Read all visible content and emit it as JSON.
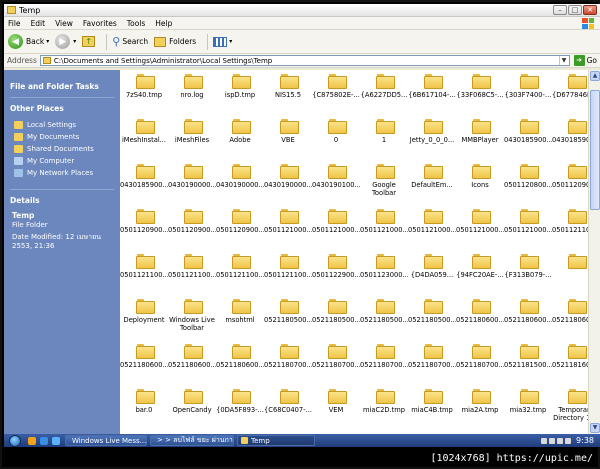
{
  "window": {
    "title": "Temp",
    "controls": {
      "minimize": "–",
      "maximize": "□",
      "close": "✕"
    }
  },
  "menu": [
    "File",
    "Edit",
    "View",
    "Favorites",
    "Tools",
    "Help"
  ],
  "toolbar": {
    "back": "Back",
    "search": "Search",
    "folders": "Folders"
  },
  "address": {
    "label": "Address",
    "value": "C:\\Documents and Settings\\Administrator\\Local Settings\\Temp",
    "go": "Go"
  },
  "sidebar": {
    "file_tasks_header": "File and Folder Tasks",
    "other_places_header": "Other Places",
    "other_places": [
      {
        "label": "Local Settings",
        "icon": "folder-icon",
        "color": "#f3cf5b"
      },
      {
        "label": "My Documents",
        "icon": "my-documents-icon",
        "color": "#f3cf5b"
      },
      {
        "label": "Shared Documents",
        "icon": "shared-documents-icon",
        "color": "#f3cf5b"
      },
      {
        "label": "My Computer",
        "icon": "my-computer-icon",
        "color": "#b8d0f0"
      },
      {
        "label": "My Network Places",
        "icon": "network-places-icon",
        "color": "#9fc3e8"
      }
    ],
    "details_header": "Details",
    "details": {
      "name": "Temp",
      "type": "File Folder",
      "modified_line1": "Date Modified: 12 เมษายน",
      "modified_line2": "2553, 21:36"
    }
  },
  "items": [
    "7zS40.tmp",
    "nro.log",
    "ispD.tmp",
    "NIS15.5",
    "{C875802E-...",
    "{A6227DD5...",
    "{6B617104-...",
    "{33F068C5-...",
    "{303F7400-...",
    "{D677846E-...",
    "iMeshInstal...",
    "iMeshFiles",
    "Adobe",
    "VBE",
    "0",
    "1",
    "Jetty_0_0_0...",
    "MMBPlayer",
    "0430185900...",
    "0430185900...",
    "0430185900...",
    "0430190000...",
    "0430190000...",
    "0430190000...",
    "0430190100...",
    "Google Toolbar",
    "DefaultEm...",
    "Icons",
    "0501120800...",
    "0501120900...",
    "0501120900...",
    "0501120900...",
    "0501120900...",
    "0501121000...",
    "0501121000...",
    "0501121000...",
    "0501121000...",
    "0501121000...",
    "0501121000...",
    "0501121100...",
    "0501121100...",
    "0501121100...",
    "0501121100...",
    "0501121100...",
    "0501122900...",
    "0501123000...",
    "{D4DA059...",
    "{94FC20AE-...",
    "{F313B079-...",
    "",
    "Deployment",
    "Windows Live Toolbar",
    "msohtml",
    "0521180500...",
    "0521180500...",
    "0521180500...",
    "0521180500...",
    "0521180600...",
    "0521180600...",
    "0521180600...",
    "0521180600...",
    "0521180600...",
    "0521180600...",
    "0521180700...",
    "0521180700...",
    "0521180700...",
    "0521180700...",
    "0521180700...",
    "0521181500...",
    "0521181600...",
    "bar.0",
    "OpenCandy",
    "{0DA5F893-...",
    "{C68C0407-...",
    "VEM",
    "miaC2D.tmp",
    "miaC4B.tmp",
    "mia2A.tmp",
    "mia32.tmp",
    "Temporary Directory 1 ..."
  ],
  "taskbar": {
    "tasks": [
      {
        "label": "Windows Live Mess...",
        "color": "#5aa0e6"
      },
      {
        "label": "> > ลบไฟล์ ขยะ ผ่านการ ... มี...",
        "color": "#e8761c"
      },
      {
        "label": "Temp",
        "color": "#f3cf5b"
      }
    ],
    "clock": "9:38"
  },
  "watermark": "[1024x768] https://upic.me/",
  "colors": {
    "sidebar": "#6b87bd",
    "titlebar": "#ffffff",
    "taskbar": "#2a4a8e"
  }
}
